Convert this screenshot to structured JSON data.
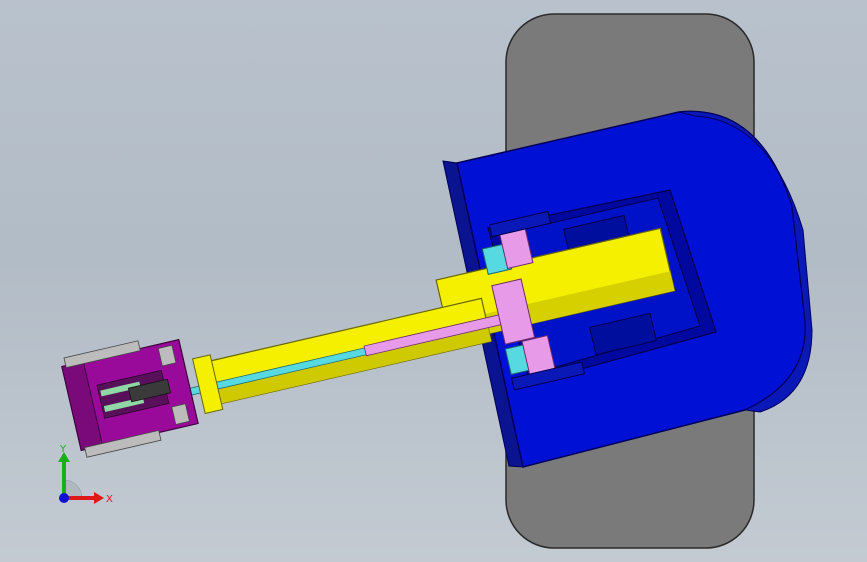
{
  "viewport": {
    "background_top": "#b9c2cc",
    "background_bottom": "#c3cad2"
  },
  "colors": {
    "base_body": "#0010d4",
    "base_side": "#0a1390",
    "track": "#7a7a7a",
    "track_outline": "#2a2a2a",
    "arm": "#f5f000",
    "arm_shade": "#c9c300",
    "joint_pink": "#e79ae8",
    "joint_cyan": "#57d9e1",
    "gripper_purple": "#9a0a9a",
    "gripper_grey": "#bcbcbc",
    "rod": "#4fd7dd"
  },
  "triad": {
    "y_label": "Y",
    "x_label": "X",
    "y_color": "#18b018",
    "x_color": "#e01818",
    "z_color": "#1010d0",
    "icon": "view-orientation-triad-icon"
  }
}
